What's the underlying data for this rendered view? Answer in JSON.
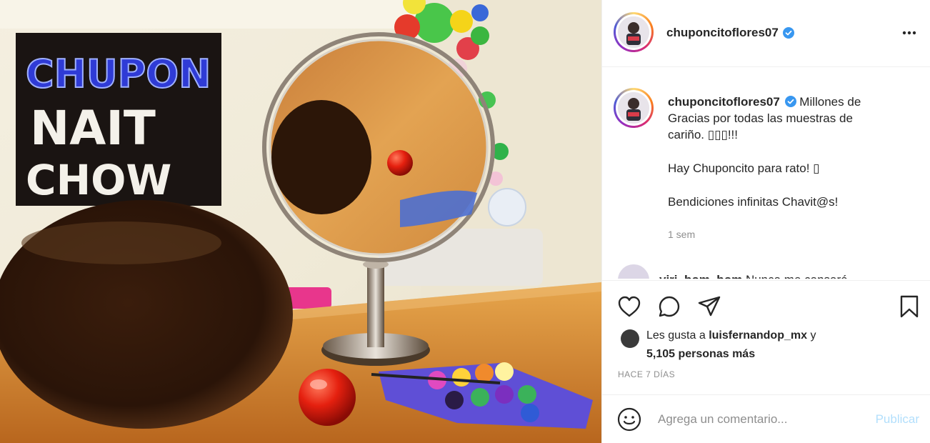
{
  "post": {
    "username": "chuponcitoflores07",
    "verified": true,
    "more_icon": "more-horizontal-icon",
    "caption_line1": "Millones de",
    "caption_line2": "Gracias por todas las muestras de",
    "caption_line3": "cariño. ▯▯▯!!!",
    "caption_line4": "Hay Chuponcito para rato! ▯",
    "caption_line5": "Bendiciones infinitas Chavit@s!",
    "caption_time": "1 sem",
    "next_comment_user": "yiri_bom_bom",
    "next_comment_text": "Nunca me cansaré",
    "likes_prefix": "Les gusta a",
    "liked_by": "luisfernandop_mx",
    "likes_joiner": "y",
    "likes_count": "5,105 personas más",
    "date": "HACE 7 DÍAS",
    "comment_placeholder": "Agrega un comentario...",
    "publish_label": "Publicar"
  },
  "photo": {
    "sign_top": "CHUPON",
    "sign_mid": "NAIT",
    "sign_bottom": "CHOW"
  },
  "colors": {
    "verified": "#3897f0",
    "publish_disabled": "#b2dffc",
    "muted": "#8e8e8e"
  }
}
